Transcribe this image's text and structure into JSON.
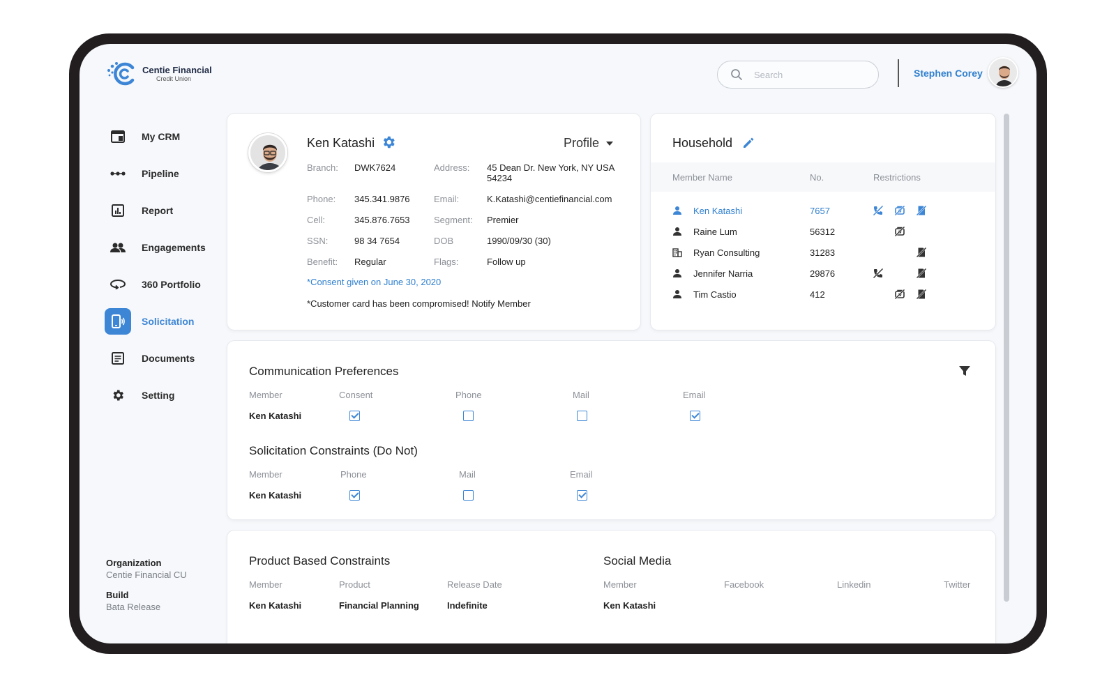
{
  "brand": {
    "name": "Centie Financial",
    "sub": "Credit Union"
  },
  "header": {
    "search_placeholder": "Search",
    "user_name": "Stephen Corey"
  },
  "nav": {
    "items": [
      {
        "label": "My CRM",
        "icon": "dashboard-icon"
      },
      {
        "label": "Pipeline",
        "icon": "pipeline-icon"
      },
      {
        "label": "Report",
        "icon": "report-icon"
      },
      {
        "label": "Engagements",
        "icon": "people-icon"
      },
      {
        "label": "360 Portfolio",
        "icon": "portfolio-icon"
      },
      {
        "label": "Solicitation",
        "icon": "solicitation-icon",
        "active": true
      },
      {
        "label": "Documents",
        "icon": "document-icon"
      },
      {
        "label": "Setting",
        "icon": "gear-icon"
      }
    ]
  },
  "footer": {
    "org_label": "Organization",
    "org_value": "Centie Financial CU",
    "build_label": "Build",
    "build_value": "Bata Release"
  },
  "profile": {
    "name": "Ken Katashi",
    "dropdown": "Profile",
    "branch_label": "Branch:",
    "branch": "DWK7624",
    "address_label": "Address:",
    "address_line1": "45  Dean Dr. New York, NY USA",
    "address_line2": "54234",
    "phone_label": "Phone:",
    "phone": "345.341.9876",
    "email_label": "Email:",
    "email": "K.Katashi@centiefinancial.com",
    "cell_label": "Cell:",
    "cell": "345.876.7653",
    "segment_label": "Segment:",
    "segment": "Premier",
    "ssn_label": "SSN:",
    "ssn": "98 34 7654",
    "dob_label": "DOB",
    "dob": "1990/09/30 (30)",
    "benefit_label": "Benefit:",
    "benefit": "Regular",
    "flags_label": "Flags:",
    "flags": "Follow up",
    "consent": "*Consent given on June 30, 2020",
    "warning": "*Customer card has been compromised! Notify Member"
  },
  "household": {
    "title": "Household",
    "col_name": "Member Name",
    "col_no": "No.",
    "col_restrictions": "Restrictions",
    "rows": [
      {
        "name": "Ken Katashi",
        "no": "7657",
        "icon": "person-icon",
        "phone": true,
        "mail": true,
        "email": true,
        "selected": true
      },
      {
        "name": "Raine Lum",
        "no": "56312",
        "icon": "person-icon",
        "phone": false,
        "mail": true,
        "email": false
      },
      {
        "name": "Ryan Consulting",
        "no": "31283",
        "icon": "building-icon",
        "phone": false,
        "mail": false,
        "email": true
      },
      {
        "name": "Jennifer Narria",
        "no": "29876",
        "icon": "person-icon",
        "phone": true,
        "mail": false,
        "email": true
      },
      {
        "name": "Tim Castio",
        "no": "412",
        "icon": "person-icon",
        "phone": false,
        "mail": true,
        "email": true
      }
    ]
  },
  "comm_prefs": {
    "title": "Communication Preferences",
    "headers": [
      "Member",
      "Consent",
      "Phone",
      "Mail",
      "Email"
    ],
    "member": "Ken Katashi",
    "values": {
      "consent": true,
      "phone": false,
      "mail": false,
      "email": true
    }
  },
  "solicitation": {
    "title": "Solicitation Constraints (Do Not)",
    "headers": [
      "Member",
      "Phone",
      "Mail",
      "Email"
    ],
    "member": "Ken Katashi",
    "values": {
      "phone": true,
      "mail": false,
      "email": true
    }
  },
  "product": {
    "title": "Product Based Constraints",
    "headers": [
      "Member",
      "Product",
      "Release Date"
    ],
    "member": "Ken Katashi",
    "product": "Financial Planning",
    "release": "Indefinite"
  },
  "social": {
    "title": "Social Media",
    "headers": [
      "Member",
      "Facebook",
      "Linkedin",
      "Twitter"
    ],
    "member": "Ken Katashi"
  },
  "colors": {
    "accent": "#3d86d6",
    "link": "#2f7fcf",
    "frame": "#221e1f"
  }
}
